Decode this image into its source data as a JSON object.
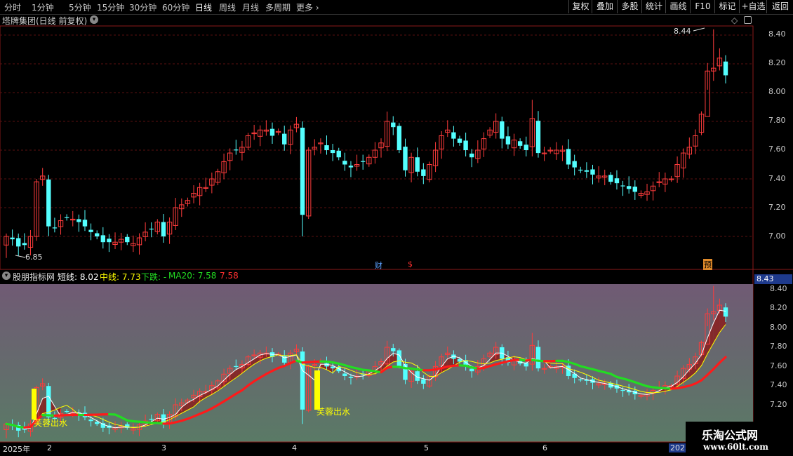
{
  "toolbar": {
    "periods": [
      "分时",
      "1分钟",
      "5分钟",
      "15分钟",
      "30分钟",
      "60分钟",
      "日线",
      "周线",
      "月线",
      "多周期",
      "更多"
    ],
    "active_period": "日线",
    "buttons": [
      "复权",
      "叠加",
      "多股",
      "统计",
      "画线",
      "F10",
      "标记",
      "+自选",
      "返回"
    ]
  },
  "chart": {
    "title": "塔牌集团(日线 前复权)",
    "high_marker": "8.44",
    "low_marker": "6.85",
    "price_ticks": [
      "8.40",
      "8.20",
      "8.00",
      "7.80",
      "7.60",
      "7.40",
      "7.20",
      "7.00"
    ],
    "event_tags": [
      "财",
      "$",
      "预"
    ]
  },
  "indicator": {
    "name": "股朋指标网",
    "short_label": "短线: 8.02",
    "mid_label": "中线: 7.73",
    "down_label": "下跌: -",
    "ma20_label": "MA20: 7.58",
    "last_value": "7.58",
    "price_tag": "8.43",
    "price_ticks": [
      "8.40",
      "8.20",
      "8.00",
      "7.80",
      "7.60",
      "7.40",
      "7.20"
    ],
    "signal_text": "芙蓉出水"
  },
  "dates": [
    "2025年",
    "2",
    "3",
    "4",
    "5",
    "6",
    "2025"
  ],
  "watermark": {
    "line1": "乐淘公式网",
    "line2": "www.60lt.com"
  },
  "colors": {
    "up": "#ff3c3c",
    "down": "#54ffff",
    "short": "#ffffff",
    "mid": "#ffff00",
    "ma20_up": "#ff1a1a",
    "ma20_down": "#22dd22",
    "band": "#8a1e1e",
    "signal": "#ffff00"
  },
  "chart_data": {
    "type": "candlestick",
    "x": [
      "c1",
      "c2",
      "c3",
      "c4",
      "c5",
      "c6",
      "c7",
      "c8",
      "c9",
      "c10",
      "c11",
      "c12",
      "c13",
      "c14",
      "c15",
      "c16",
      "c17",
      "c18",
      "c19",
      "c20",
      "c21",
      "c22",
      "c23",
      "c24",
      "c25",
      "c26",
      "c27",
      "c28",
      "c29",
      "c30",
      "c31",
      "c32",
      "c33",
      "c34",
      "c35",
      "c36",
      "c37",
      "c38",
      "c39",
      "c40",
      "c41",
      "c42",
      "c43",
      "c44",
      "c45",
      "c46",
      "c47",
      "c48",
      "c49",
      "c50",
      "c51",
      "c52",
      "c53",
      "c54",
      "c55",
      "c56",
      "c57",
      "c58",
      "c59",
      "c60",
      "c61",
      "c62",
      "c63",
      "c64",
      "c65",
      "c66",
      "c67",
      "c68",
      "c69",
      "c70",
      "c71",
      "c72",
      "c73",
      "c74",
      "c75",
      "c76",
      "c77",
      "c78",
      "c79",
      "c80",
      "c81",
      "c82",
      "c83",
      "c84",
      "c85",
      "c86",
      "c87",
      "c88",
      "c89",
      "c90",
      "c91",
      "c92",
      "c93",
      "c94",
      "c95",
      "c96",
      "c97",
      "c98",
      "c99",
      "c100",
      "c101",
      "c102",
      "c103",
      "c104",
      "c105",
      "c106",
      "c107",
      "c108",
      "c109",
      "c110",
      "c111",
      "c112",
      "c113",
      "c114",
      "c115",
      "c116",
      "c117",
      "c118",
      "c119",
      "c120",
      "c121",
      "c122",
      "c123",
      "c124",
      "c125",
      "c126",
      "c127",
      "c128",
      "c129",
      "c130",
      "c131",
      "c132",
      "c133",
      "c134",
      "c135",
      "c136",
      "c137",
      "c138",
      "c139"
    ],
    "close": [
      7.0,
      6.98,
      6.93,
      6.94,
      7.0,
      7.38,
      7.42,
      7.07,
      7.06,
      7.11,
      7.13,
      7.12,
      7.1,
      7.07,
      7.03,
      7.0,
      6.96,
      6.96,
      6.96,
      6.98,
      6.96,
      6.95,
      6.99,
      7.03,
      7.05,
      7.1,
      7.0,
      7.1,
      7.2,
      7.22,
      7.25,
      7.3,
      7.34,
      7.34,
      7.4,
      7.45,
      7.52,
      7.58,
      7.6,
      7.62,
      7.7,
      7.72,
      7.74,
      7.74,
      7.7,
      7.73,
      7.64,
      7.74,
      7.78,
      7.15,
      7.6,
      7.62,
      7.65,
      7.6,
      7.58,
      7.55,
      7.5,
      7.48,
      7.5,
      7.52,
      7.55,
      7.6,
      7.65,
      7.8,
      7.76,
      7.6,
      7.46,
      7.55,
      7.45,
      7.42,
      7.5,
      7.6,
      7.7,
      7.74,
      7.68,
      7.65,
      7.6,
      7.55,
      7.6,
      7.68,
      7.74,
      7.8,
      7.68,
      7.64,
      7.67,
      7.63,
      7.6,
      7.82,
      7.58,
      7.58,
      7.6,
      7.6,
      7.6,
      7.5,
      7.48,
      7.46,
      7.45,
      7.43,
      7.42,
      7.42,
      7.38,
      7.37,
      7.35,
      7.33,
      7.31,
      7.3,
      7.31,
      7.35,
      7.38,
      7.4,
      7.4,
      7.5,
      7.58,
      7.62,
      7.7,
      7.85,
      8.15,
      8.17,
      8.24,
      8.12
    ]
  }
}
